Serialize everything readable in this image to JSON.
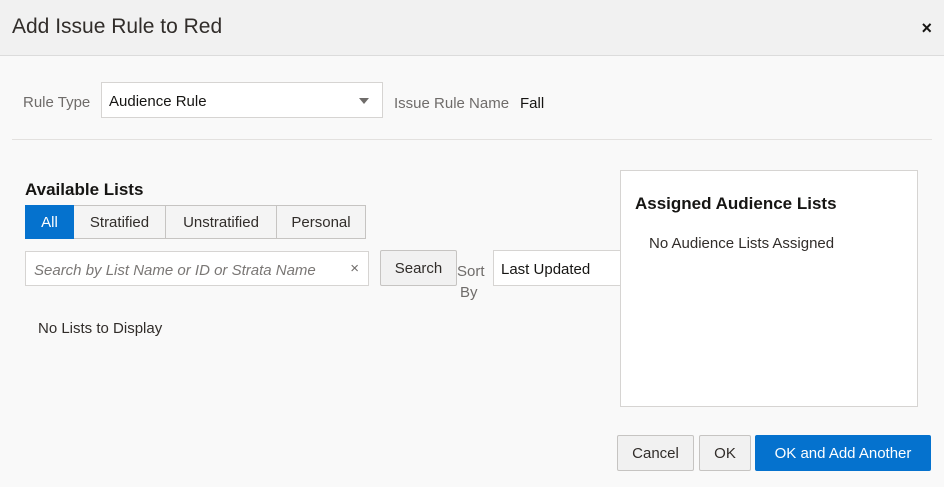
{
  "dialog": {
    "title": "Add Issue Rule to Red",
    "close_label": "×"
  },
  "form": {
    "rule_type_label": "Rule Type",
    "rule_type_value": "Audience Rule",
    "issue_rule_name_label": "Issue Rule Name",
    "issue_rule_name_value": "Fall"
  },
  "available": {
    "title": "Available Lists",
    "filters": [
      "All",
      "Stratified",
      "Unstratified",
      "Personal"
    ],
    "active_filter": "All",
    "search_placeholder": "Search by List Name or ID or Strata Name",
    "clear_label": "×",
    "search_button": "Search",
    "sort_label_line1": "Sort",
    "sort_label_line2": "By",
    "sort_value": "Last Updated",
    "empty_message": "No Lists to Display"
  },
  "assigned": {
    "title": "Assigned Audience Lists",
    "empty_message": "No Audience Lists Assigned"
  },
  "footer": {
    "cancel": "Cancel",
    "ok": "OK",
    "ok_add_another": "OK and Add Another"
  },
  "colors": {
    "accent": "#0572ce"
  }
}
